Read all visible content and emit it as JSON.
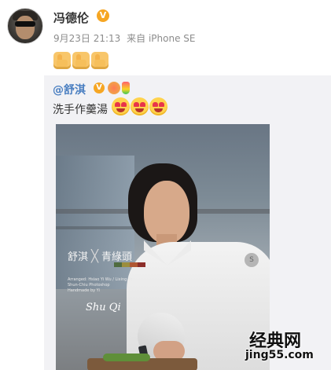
{
  "post": {
    "author": "冯德伦",
    "verified_badge": "V",
    "meta": {
      "date": "9月23日 21:13",
      "source": "来自 iPhone SE"
    },
    "reaction_icons": [
      "thumbs-up-emoji",
      "thumbs-up-emoji",
      "thumbs-up-emoji"
    ]
  },
  "repost": {
    "mention": "@舒淇",
    "verified_badge": "V",
    "text": "洗手作羹湯",
    "emoji_icons": [
      "heart-eyes-emoji",
      "heart-eyes-emoji",
      "heart-eyes-emoji"
    ],
    "photo": {
      "brand_left": "舒淇",
      "brand_x": "╳",
      "brand_right": "青綠頭",
      "credit_lines": [
        "Arranged: Hsiao Yi Wu / Lixing Ye",
        "Shun-Chiu Photoshop",
        "Handmade by Yi"
      ],
      "signature": "Shu Qi",
      "patch": "S"
    }
  },
  "watermark": {
    "brand": "经典网",
    "url": "jing55.com"
  },
  "colors": {
    "mention": "#4a7fc1",
    "badge": "#f6a623",
    "meta": "#8c8c8c"
  }
}
